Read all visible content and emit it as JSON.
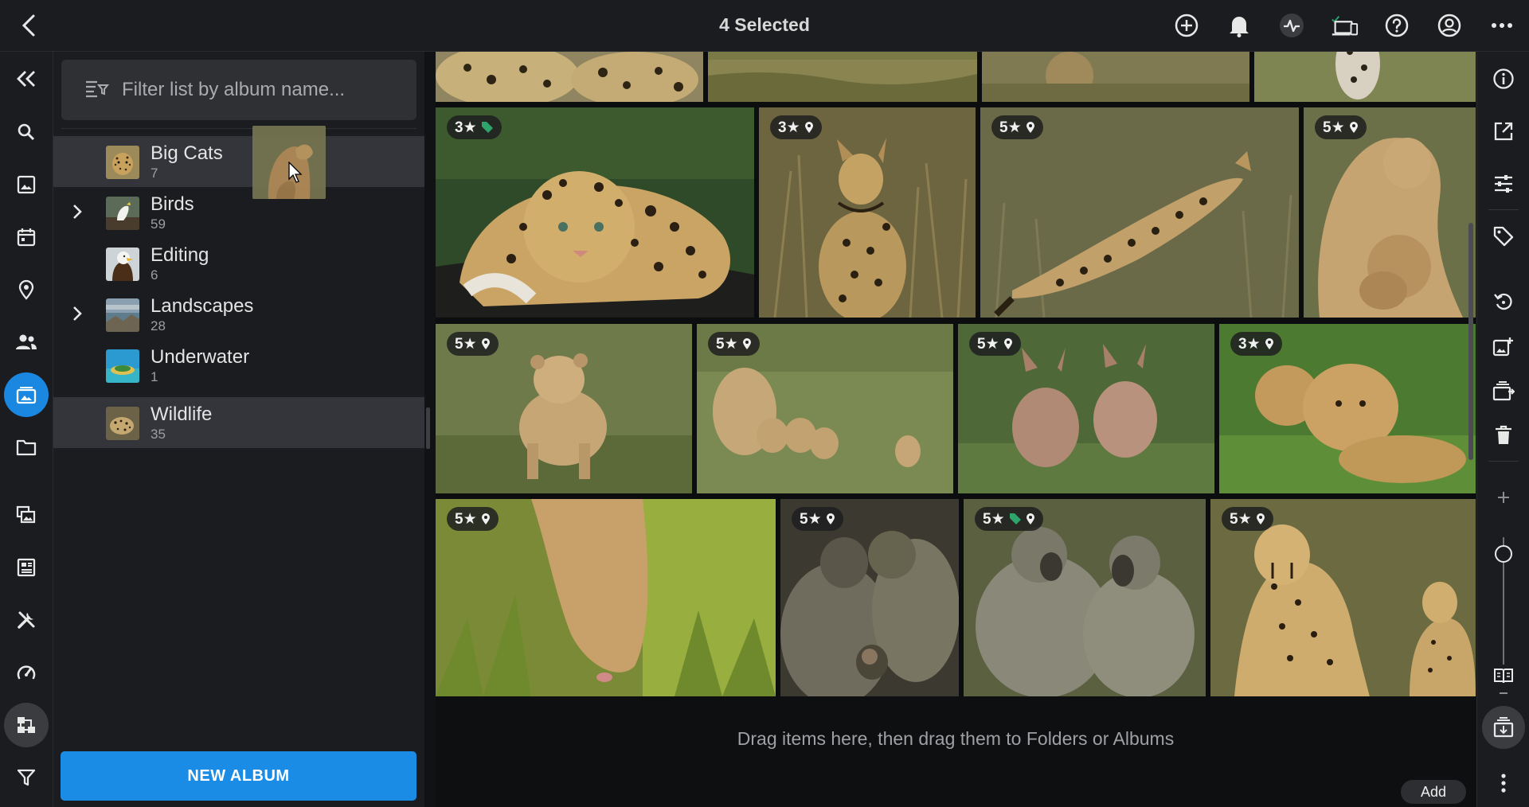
{
  "header": {
    "title": "4 Selected",
    "icons": [
      "back-icon",
      "add-circle-icon",
      "bell-icon",
      "activity-icon",
      "devices-icon",
      "help-icon",
      "account-icon",
      "more-icon"
    ]
  },
  "colors": {
    "accent": "#1b8ce6",
    "selection": "#3ea6f2",
    "tag_green": "#2ea36a",
    "panel": "#1b1c1f",
    "grid_bg": "#0c0d0e"
  },
  "left_rail": {
    "items": [
      "collapse-icon",
      "search-icon",
      "photos-icon",
      "calendar-icon",
      "map-pin-icon",
      "people-icon",
      "albums-icon",
      "folder-icon",
      "collections-icon",
      "dashboard-icon",
      "tools-icon",
      "speed-icon",
      "hierarchy-icon",
      "filter-icon"
    ],
    "active": "albums-icon"
  },
  "album_panel": {
    "filter_placeholder": "Filter list by album name...",
    "albums": [
      {
        "name": "Big Cats",
        "count": "7",
        "expandable": false,
        "highlighted": true
      },
      {
        "name": "Birds",
        "count": "59",
        "expandable": true,
        "highlighted": false
      },
      {
        "name": "Editing",
        "count": "6",
        "expandable": false,
        "highlighted": false
      },
      {
        "name": "Landscapes",
        "count": "28",
        "expandable": true,
        "highlighted": false
      },
      {
        "name": "Underwater",
        "count": "1",
        "expandable": false,
        "highlighted": false
      },
      {
        "name": "Wildlife",
        "count": "35",
        "expandable": false,
        "highlighted": true
      }
    ],
    "new_album_label": "NEW ALBUM"
  },
  "grid": {
    "rows": [
      {
        "photos": [
          {
            "subject": "leopards-partial",
            "rating": ""
          },
          {
            "subject": "grass-partial",
            "rating": ""
          },
          {
            "subject": "cat-partial",
            "rating": ""
          },
          {
            "subject": "leopard-feet-partial",
            "rating": ""
          }
        ]
      },
      {
        "photos": [
          {
            "subject": "leopard-resting",
            "rating": "3★",
            "tag": true,
            "location": false,
            "selected": true
          },
          {
            "subject": "serval-sitting",
            "rating": "3★",
            "tag": false,
            "location": true,
            "selected": true
          },
          {
            "subject": "serval-leaping",
            "rating": "5★",
            "tag": false,
            "location": true,
            "selected": true
          },
          {
            "subject": "lioness-with-cubs",
            "rating": "5★",
            "tag": false,
            "location": true,
            "selected": true
          }
        ]
      },
      {
        "photos": [
          {
            "subject": "lion-cub",
            "rating": "5★",
            "tag": false,
            "location": true,
            "selected": false
          },
          {
            "subject": "lion-family",
            "rating": "5★",
            "tag": false,
            "location": true,
            "selected": false
          },
          {
            "subject": "jackals",
            "rating": "5★",
            "tag": false,
            "location": true,
            "selected": false
          },
          {
            "subject": "lion-cubs-grass",
            "rating": "3★",
            "tag": false,
            "location": true,
            "selected": false
          }
        ]
      },
      {
        "photos": [
          {
            "subject": "lioness-drinking",
            "rating": "5★",
            "tag": false,
            "location": true,
            "selected": false
          },
          {
            "subject": "baboon-with-baby",
            "rating": "5★",
            "tag": false,
            "location": true,
            "selected": false
          },
          {
            "subject": "baboons-grooming",
            "rating": "5★",
            "tag": true,
            "location": true,
            "selected": false
          },
          {
            "subject": "cheetahs",
            "rating": "5★",
            "tag": false,
            "location": true,
            "selected": false
          }
        ]
      }
    ]
  },
  "dropzone": {
    "text": "Drag items here, then drag them to Folders or Albums",
    "add_label": "Add"
  },
  "right_rail": {
    "items": [
      "info-icon",
      "open-external-icon",
      "adjustments-icon",
      "tag-icon",
      "rotate-icon",
      "add-to-album-icon",
      "move-icon",
      "trash-icon",
      "zoom-in-icon",
      "zoom-out-icon",
      "book-icon",
      "stack-icon",
      "more-vertical-icon"
    ]
  }
}
